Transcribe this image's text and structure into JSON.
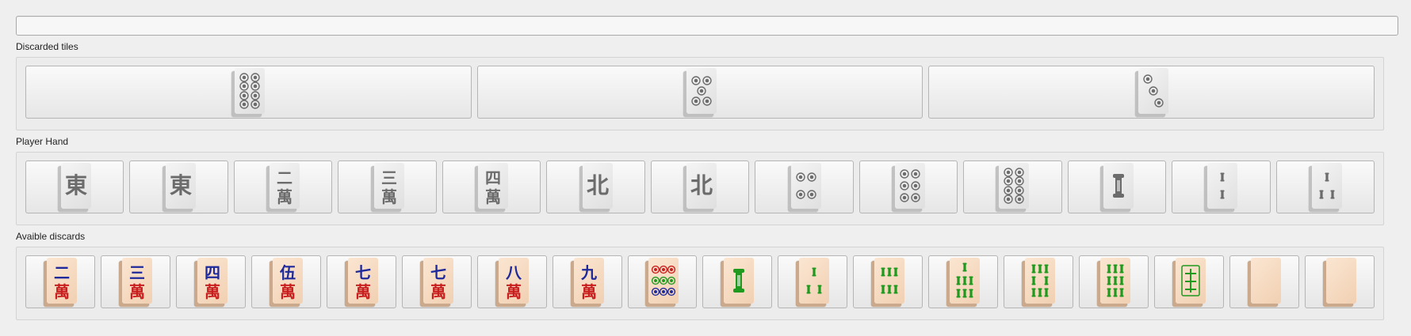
{
  "sections": {
    "discarded_label": "Discarded tiles",
    "hand_label": "Player Hand",
    "available_label": "Avaible discards"
  },
  "discarded": [
    {
      "icon": "circles-8-tile-icon"
    },
    {
      "icon": "circles-5-tile-icon"
    },
    {
      "icon": "circles-3-tile-icon"
    }
  ],
  "hand": [
    {
      "icon": "east-wind-tile-icon",
      "glyph": "東"
    },
    {
      "icon": "east-wind-tile-icon",
      "glyph": "東"
    },
    {
      "icon": "characters-2-tile-icon",
      "glyph": "二"
    },
    {
      "icon": "characters-3-tile-icon",
      "glyph": "三"
    },
    {
      "icon": "characters-4-tile-icon",
      "glyph": "四"
    },
    {
      "icon": "north-wind-tile-icon",
      "glyph": "北"
    },
    {
      "icon": "north-wind-tile-icon",
      "glyph": "北"
    },
    {
      "icon": "circles-4-tile-icon"
    },
    {
      "icon": "circles-6-tile-icon"
    },
    {
      "icon": "circles-8-tile-icon"
    },
    {
      "icon": "bamboo-1-tile-icon"
    },
    {
      "icon": "bamboo-2-tile-icon"
    },
    {
      "icon": "bamboo-3-tile-icon"
    }
  ],
  "available": [
    {
      "icon": "characters-2-tile-icon",
      "glyph": "二"
    },
    {
      "icon": "characters-3-tile-icon",
      "glyph": "三"
    },
    {
      "icon": "characters-4-tile-icon",
      "glyph": "四"
    },
    {
      "icon": "characters-5-tile-icon",
      "glyph": "伍"
    },
    {
      "icon": "characters-7-tile-icon",
      "glyph": "七"
    },
    {
      "icon": "characters-7-tile-icon",
      "glyph": "七"
    },
    {
      "icon": "characters-8-tile-icon",
      "glyph": "八"
    },
    {
      "icon": "characters-9-tile-icon",
      "glyph": "九"
    },
    {
      "icon": "circles-9-tile-icon"
    },
    {
      "icon": "bamboo-1-tile-icon"
    },
    {
      "icon": "bamboo-3-tile-icon"
    },
    {
      "icon": "bamboo-6-tile-icon"
    },
    {
      "icon": "bamboo-7-tile-icon"
    },
    {
      "icon": "bamboo-8-tile-icon"
    },
    {
      "icon": "bamboo-9-tile-icon"
    },
    {
      "icon": "green-dragon-tile-icon"
    },
    {
      "icon": "white-dragon-tile-icon"
    },
    {
      "icon": "white-dragon-tile-icon"
    }
  ],
  "colors": {
    "character_red": "#c81e1e",
    "character_blue": "#1e2a9c",
    "bamboo_green": "#1f9a1f",
    "circle_red": "#c81e1e",
    "circle_green": "#1f9a1f",
    "circle_blue": "#1e2a9c"
  }
}
